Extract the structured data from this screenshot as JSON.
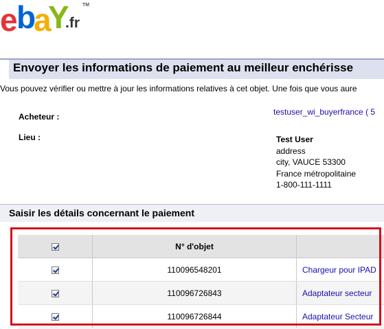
{
  "logo": {
    "e": "e",
    "b": "b",
    "a": "a",
    "y": "Y",
    "suffix": ".fr",
    "trademark": "TM"
  },
  "page": {
    "title": "Envoyer les informations de paiement au meilleur enchérisse",
    "intro": "Vous pouvez vérifier ou mettre à jour les informations relatives à cet objet. Une fois que vous aure"
  },
  "buyer": {
    "label": "Acheteur :",
    "value": "testuser_wi_buyerfrance ( 5"
  },
  "place": {
    "label": "Lieu :",
    "name": "Test User",
    "line1": "address",
    "line2": "city, VAUCE 53300",
    "line3": "France métropolitaine",
    "phone": "1-800-111-1111"
  },
  "section": {
    "title": "Saisir les détails concernant le paiement"
  },
  "table": {
    "header_item": "N° d'objet",
    "header_checked": true,
    "rows": [
      {
        "checked": true,
        "item_number": "110096548201",
        "title": "Chargeur pour IPAD"
      },
      {
        "checked": true,
        "item_number": "110096726843",
        "title": "Adaptateur secteur"
      },
      {
        "checked": true,
        "item_number": "110096726844",
        "title": "Adaptateur Secteur"
      }
    ]
  },
  "colors": {
    "logo_e": "#e53238",
    "logo_b": "#0064d2",
    "logo_a": "#f5af02",
    "logo_y": "#86b817",
    "title_bar": "#dde0ef",
    "link": "#1a0dab",
    "highlight": "#d0101c"
  }
}
